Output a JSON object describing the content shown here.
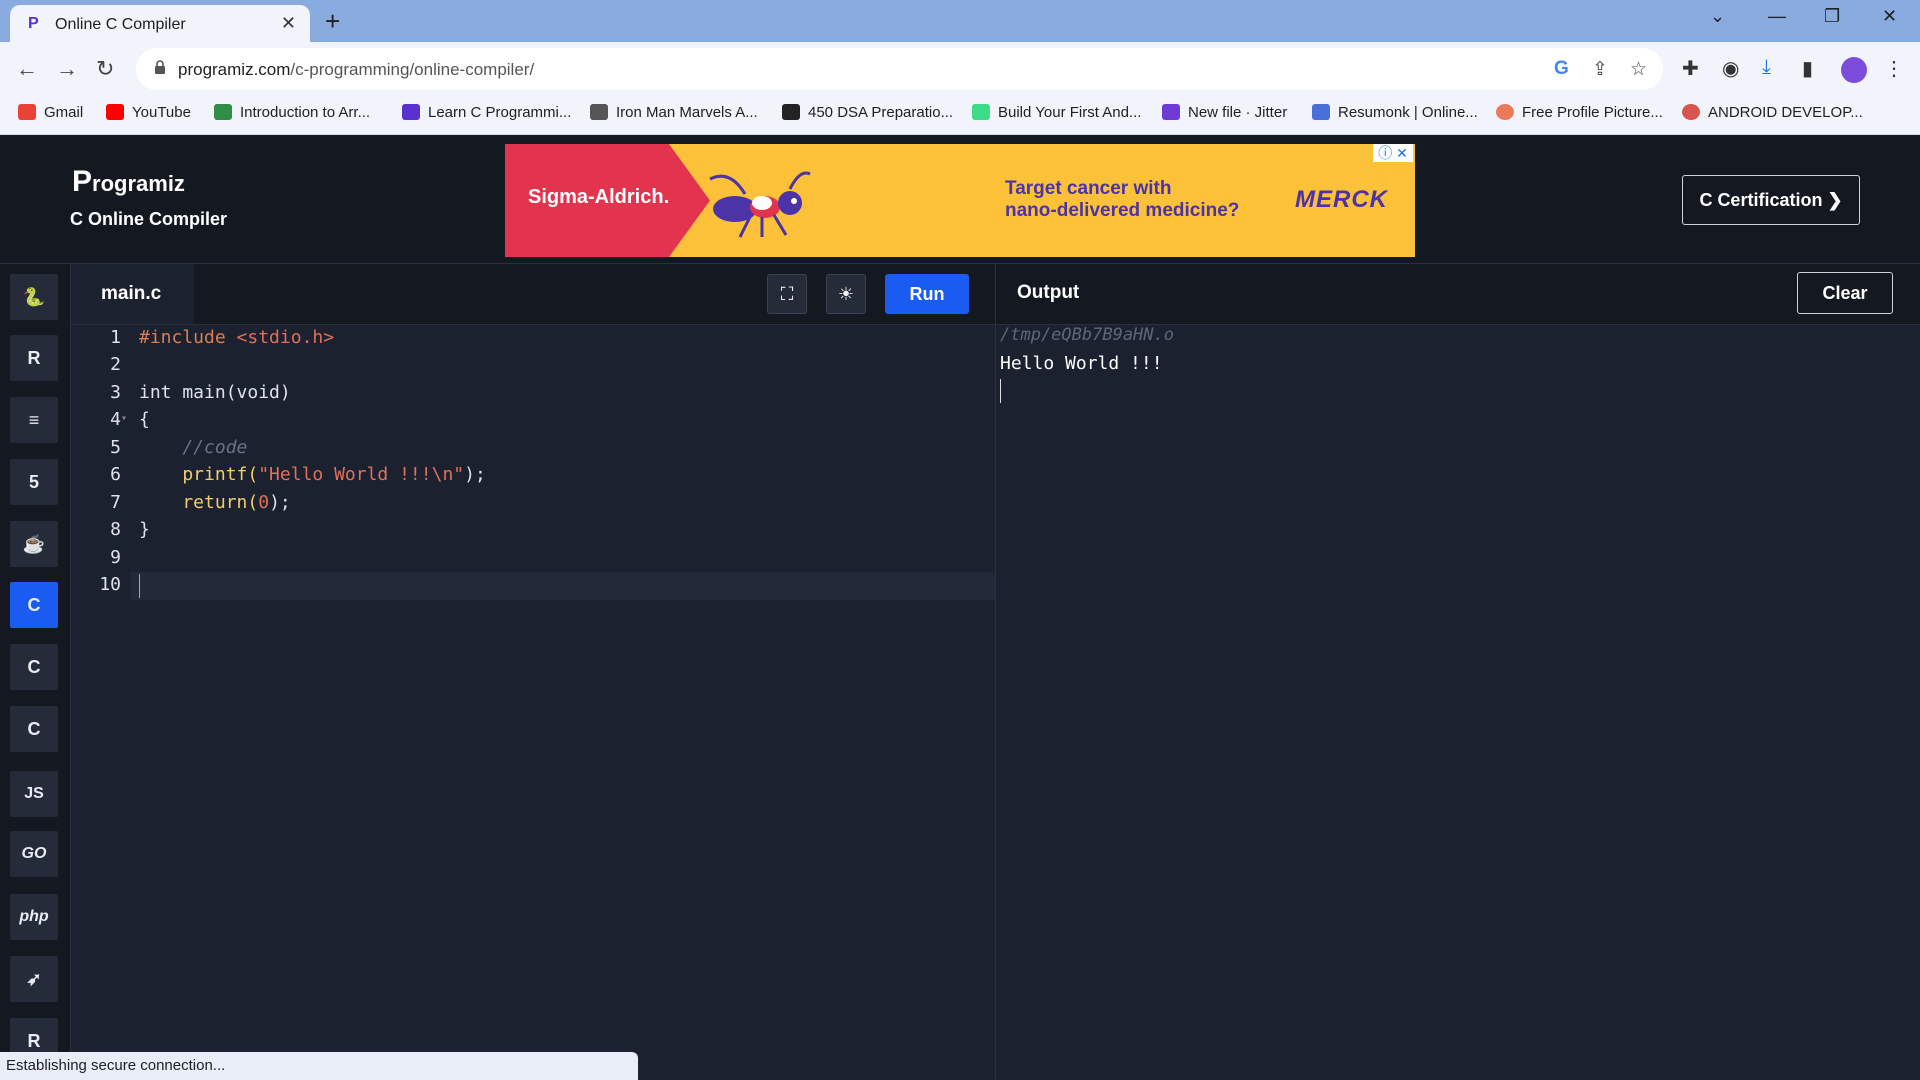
{
  "browser": {
    "tab_title": "Online C Compiler",
    "tab_close": "✕",
    "new_tab": "+",
    "url_host": "programiz.com",
    "url_path": "/c-programming/online-compiler/",
    "window_controls": [
      "⌄",
      "—",
      "❐",
      "✕"
    ],
    "bookmarks": [
      {
        "label": "Gmail",
        "color": "#ea4335"
      },
      {
        "label": "YouTube",
        "color": "#ff0000"
      },
      {
        "label": "Introduction to Arr...",
        "color": "#2f8d46"
      },
      {
        "label": "Learn C Programmi...",
        "color": "#5a31d1"
      },
      {
        "label": "Iron Man Marvels A...",
        "color": "#555555"
      },
      {
        "label": "450 DSA Preparatio...",
        "color": "#222222"
      },
      {
        "label": "Build Your First And...",
        "color": "#3ddc84"
      },
      {
        "label": "New file · Jitter",
        "color": "#6e3bd8"
      },
      {
        "label": "Resumonk | Online...",
        "color": "#4a6fd6"
      },
      {
        "label": "Free Profile Picture...",
        "color": "#e97a5c"
      },
      {
        "label": "ANDROID DEVELOP...",
        "color": "#d9534f"
      }
    ]
  },
  "site": {
    "logo": "rogramiz",
    "logo_p": "P",
    "subtitle": "C Online Compiler",
    "certification_button": "C Certification ❯",
    "ad": {
      "brand": "Sigma-Aldrich.",
      "headline_line1": "Target cancer with",
      "headline_line2": "nano-delivered medicine?",
      "sponsor": "MERCK"
    }
  },
  "sidebar": {
    "languages": [
      {
        "name": "python",
        "glyph": "🐍"
      },
      {
        "name": "r",
        "glyph": "R"
      },
      {
        "name": "sql",
        "glyph": "≡"
      },
      {
        "name": "html",
        "glyph": "5"
      },
      {
        "name": "java",
        "glyph": "☕"
      },
      {
        "name": "c",
        "glyph": "C",
        "active": true
      },
      {
        "name": "cpp",
        "glyph": "C"
      },
      {
        "name": "csharp",
        "glyph": "C"
      },
      {
        "name": "javascript",
        "glyph": "JS"
      },
      {
        "name": "go",
        "glyph": "GO"
      },
      {
        "name": "php",
        "glyph": "php"
      },
      {
        "name": "swift",
        "glyph": "➶"
      },
      {
        "name": "rust",
        "glyph": "R"
      }
    ]
  },
  "editor": {
    "filename": "main.c",
    "run_label": "Run",
    "line_numbers": [
      "1",
      "2",
      "3",
      "4",
      "5",
      "6",
      "7",
      "8",
      "9",
      "10"
    ],
    "code": {
      "l1_kw": "#include ",
      "l1_inc": "<stdio.h>",
      "l3": "int main(void)",
      "l4": "{",
      "l5": "    //code",
      "l6_fn": "    printf(",
      "l6_str": "\"Hello World !!!\\n\"",
      "l6_end": ");",
      "l7_fn": "    return(",
      "l7_num": "0",
      "l7_end": ");",
      "l8": "}"
    }
  },
  "output": {
    "title": "Output",
    "clear_label": "Clear",
    "path": "/tmp/eQBb7B9aHN.o",
    "text": "Hello World !!!"
  },
  "status": {
    "text": "Establishing secure connection..."
  }
}
